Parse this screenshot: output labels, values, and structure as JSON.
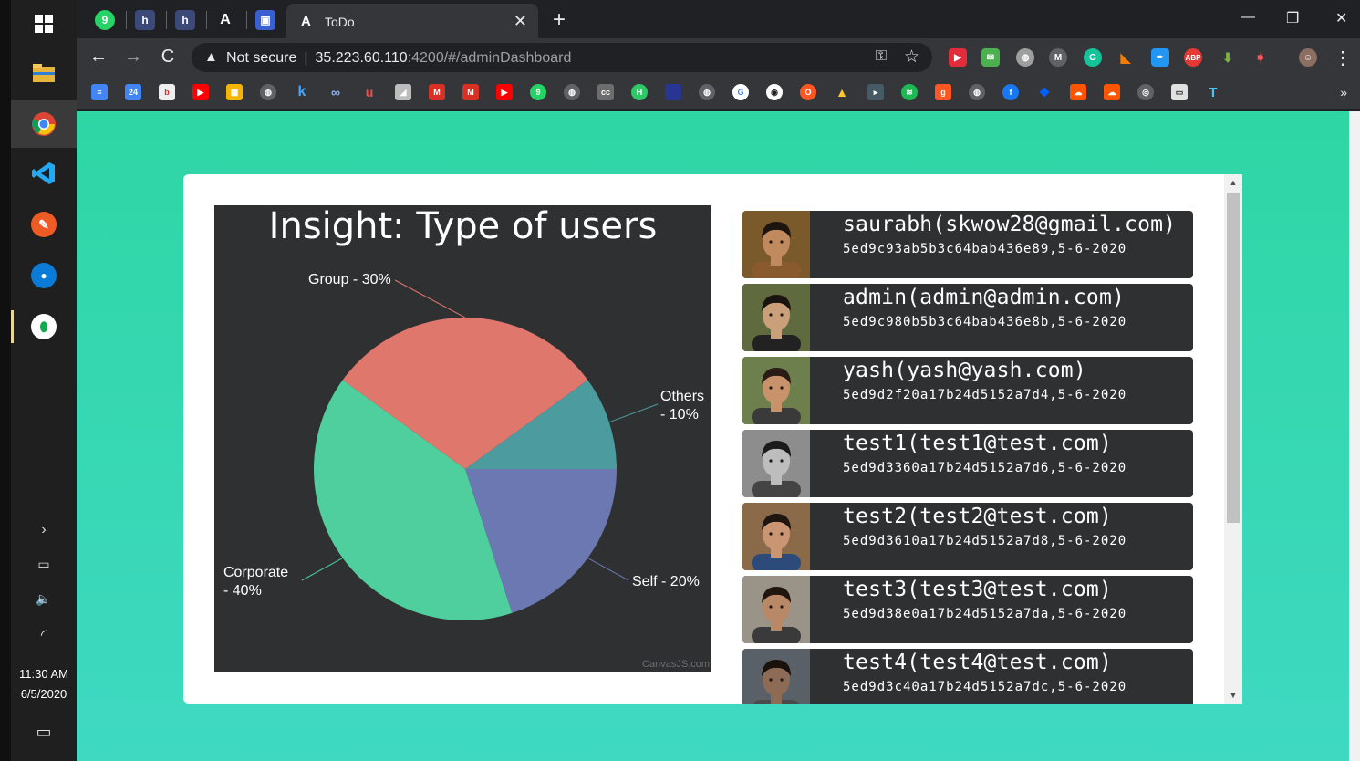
{
  "taskbar": {
    "apps": [
      {
        "name": "windows-start",
        "icon": "windows-icon"
      },
      {
        "name": "file-explorer",
        "icon": "folder-icon"
      },
      {
        "name": "chrome",
        "icon": "chrome-icon"
      },
      {
        "name": "vscode",
        "icon": "vscode-icon"
      },
      {
        "name": "postman",
        "icon": "postman-icon"
      },
      {
        "name": "maps",
        "icon": "location-icon"
      },
      {
        "name": "mongodb-compass",
        "icon": "mongodb-icon"
      }
    ],
    "tray": {
      "expand_glyph": "›",
      "battery_glyph": "▭",
      "volume_glyph": "🔈",
      "wifi_glyph": "◜"
    },
    "clock": {
      "time": "11:30 AM",
      "date": "6/5/2020"
    },
    "notifications_glyph": "▭"
  },
  "browser": {
    "tab": {
      "title": "ToDo",
      "favicon": "A",
      "close_glyph": "✕"
    },
    "new_tab_glyph": "+",
    "window_controls": {
      "minimize": "—",
      "restore": "❐",
      "close": "✕"
    },
    "nav": {
      "back": "←",
      "forward": "→",
      "reload": "C"
    },
    "address": {
      "security_glyph": "▲",
      "security_label": "Not secure",
      "host": "35.223.60.110",
      "path": ":4200/#/adminDashboard"
    },
    "key_glyph": "⚿",
    "star_glyph": "☆",
    "menu_glyph": "⋮",
    "bookmarks_more": "»"
  },
  "accent_colors": {
    "page_gradient_top": "#2ed6a4",
    "page_gradient_bottom": "#3fd9c2",
    "panel_dark": "#2e3032"
  },
  "chart_data": {
    "type": "pie",
    "title": "Insight: Type of users",
    "credit": "CanvasJS.com",
    "slices": [
      {
        "label": "Others",
        "value": 10,
        "display": "Others - 10%",
        "color": "#4c9b9e"
      },
      {
        "label": "Self",
        "value": 20,
        "display": "Self - 20%",
        "color": "#6b78b2"
      },
      {
        "label": "Corporate",
        "value": 40,
        "display": "Corporate - 40%",
        "color": "#4fcf9d"
      },
      {
        "label": "Group",
        "value": 30,
        "display": "Group - 30%",
        "color": "#df776d"
      }
    ],
    "label_lines": {
      "others": [
        "Others",
        "- 10%"
      ],
      "self": [
        "Self - 20%"
      ],
      "corporate": [
        "Corporate",
        "- 40%"
      ],
      "group": [
        "Group - 30%"
      ]
    }
  },
  "users": [
    {
      "name": "saurabh(skwow28@gmail.com)",
      "meta": "5ed9c93ab5b3c64bab436e89,5-6-2020",
      "avatar": {
        "skin": "#c08a5e",
        "hair": "#1d1410",
        "bg": "#7a5a2a",
        "shirt": "#8a5a2f"
      }
    },
    {
      "name": "admin(admin@admin.com)",
      "meta": "5ed9c980b5b3c64bab436e8b,5-6-2020",
      "avatar": {
        "skin": "#c9a07a",
        "hair": "#1a1410",
        "bg": "#5f6b3e",
        "shirt": "#222"
      }
    },
    {
      "name": "yash(yash@yash.com)",
      "meta": "5ed9d2f20a17b24d5152a7d4,5-6-2020",
      "avatar": {
        "skin": "#c8936a",
        "hair": "#2a1c14",
        "bg": "#6e7f4e",
        "shirt": "#3a3a3a"
      }
    },
    {
      "name": "test1(test1@test.com)",
      "meta": "5ed9d3360a17b24d5152a7d6,5-6-2020",
      "avatar": {
        "skin": "#bdbdbd",
        "hair": "#1b1b1b",
        "bg": "#8d8d8d",
        "shirt": "#444"
      }
    },
    {
      "name": "test2(test2@test.com)",
      "meta": "5ed9d3610a17b24d5152a7d8,5-6-2020",
      "avatar": {
        "skin": "#c99572",
        "hair": "#1e1410",
        "bg": "#8b6a4a",
        "shirt": "#2d4b7a"
      }
    },
    {
      "name": "test3(test3@test.com)",
      "meta": "5ed9d38e0a17b24d5152a7da,5-6-2020",
      "avatar": {
        "skin": "#b98866",
        "hair": "#20160f",
        "bg": "#9a9388",
        "shirt": "#3a3a3a"
      }
    },
    {
      "name": "test4(test4@test.com)",
      "meta": "5ed9d3c40a17b24d5152a7dc,5-6-2020",
      "avatar": {
        "skin": "#8d6b55",
        "hair": "#18110c",
        "bg": "#5a6068",
        "shirt": "#4a4a4a"
      }
    }
  ],
  "scroll": {
    "up_glyph": "▲",
    "down_glyph": "▼"
  }
}
